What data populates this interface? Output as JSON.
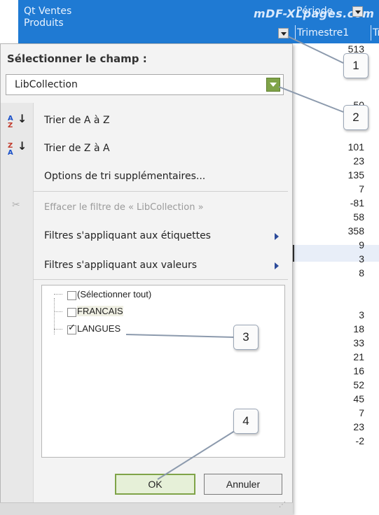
{
  "header": {
    "measure_label": "Qt Ventes",
    "rows_label": "Produits",
    "column_field_label": "Période",
    "watermark": "mDF-XLpages.com",
    "quarter1": "Trimestre1",
    "quarter2": "Tr"
  },
  "values_column": [
    "513",
    "",
    "",
    "",
    "50",
    "",
    "",
    "101",
    "23",
    "135",
    "7",
    "-81",
    "58",
    "358",
    "9",
    "3",
    "8",
    "",
    "",
    "3",
    "18",
    "33",
    "21",
    "16",
    "52",
    "45",
    "7",
    "23",
    "-2"
  ],
  "panel": {
    "title": "Sélectionner le champ :",
    "selected_field": "LibCollection",
    "menu": {
      "sort_az": "Trier de A à Z",
      "sort_za": "Trier de Z à A",
      "more_sort": "Options de tri supplémentaires...",
      "clear_filter": "Effacer le filtre de « LibCollection »",
      "label_filters": "Filtres s'appliquant aux étiquettes",
      "value_filters": "Filtres s'appliquant aux valeurs"
    },
    "checklist": [
      {
        "label": "(Sélectionner tout)",
        "checked": false
      },
      {
        "label": "FRANCAIS",
        "checked": false
      },
      {
        "label": "LANGUES",
        "checked": true
      }
    ],
    "buttons": {
      "ok": "OK",
      "cancel": "Annuler"
    }
  },
  "callouts": [
    "1",
    "2",
    "3",
    "4"
  ],
  "icons": {
    "sort_az": "sort-ascending-icon",
    "sort_za": "sort-descending-icon",
    "clear_filter": "clear-filter-icon",
    "submenu": "submenu-arrow-icon",
    "dropdown": "dropdown-arrow-icon"
  },
  "colors": {
    "header_blue": "#1f7ad3",
    "ok_green": "#7fa348",
    "panel_bg": "#f3f3f3"
  }
}
